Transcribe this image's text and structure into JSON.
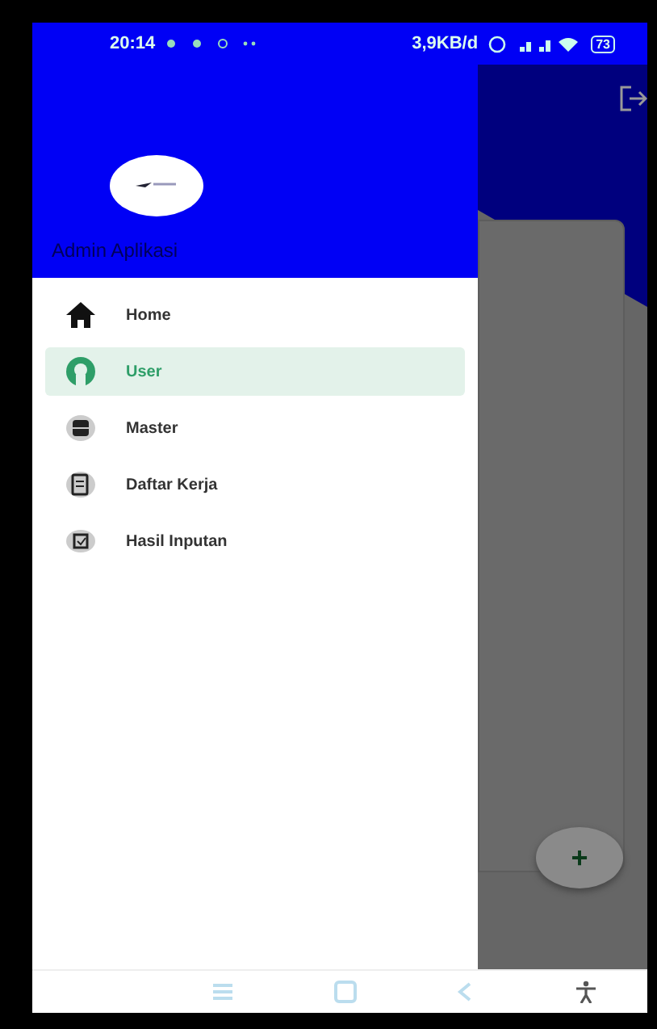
{
  "status_bar": {
    "time": "20:14",
    "speed": "3,9KB/d",
    "battery": "73"
  },
  "drawer": {
    "title": "Admin Aplikasi",
    "items": [
      {
        "label": "Home",
        "kind": "home",
        "selected": false
      },
      {
        "label": "User",
        "kind": "user",
        "selected": true
      },
      {
        "label": "Master",
        "kind": "database",
        "selected": false
      },
      {
        "label": "Daftar Kerja",
        "kind": "list",
        "selected": false
      },
      {
        "label": "Hasil Inputan",
        "kind": "check",
        "selected": false
      }
    ]
  },
  "fab": {
    "label": "+"
  }
}
